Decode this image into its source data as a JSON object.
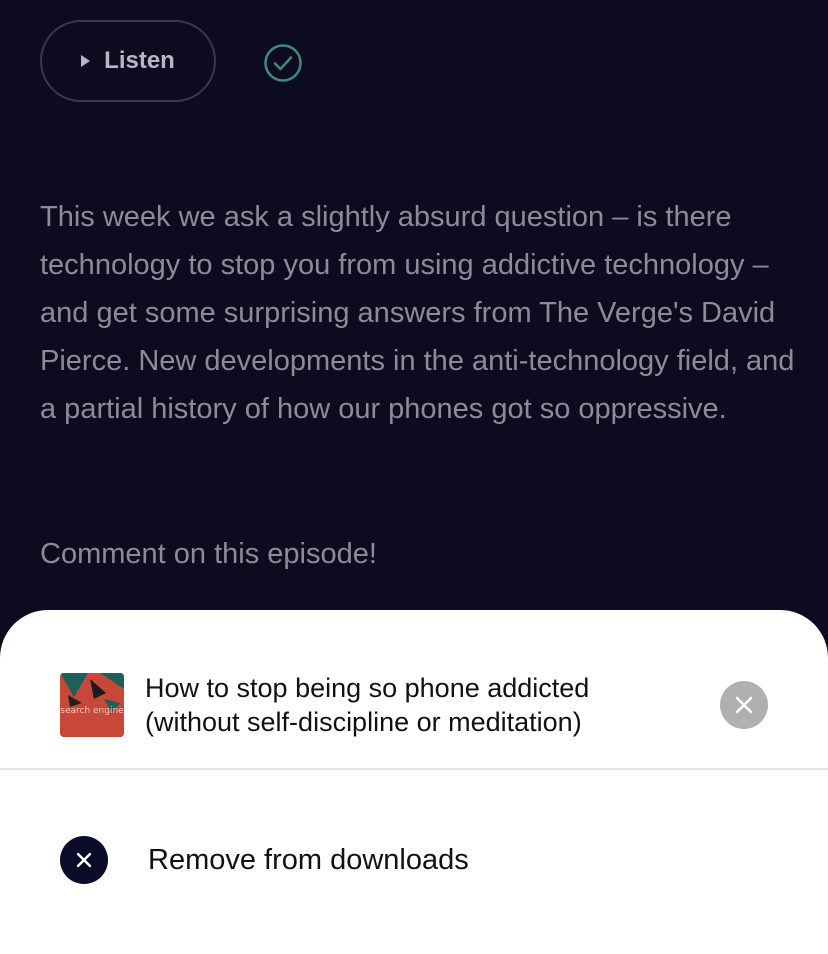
{
  "top": {
    "listen_label": "Listen",
    "play_icon": "play-icon",
    "check_icon": "checkmark-circle-icon"
  },
  "episode": {
    "description": "This week we ask a slightly absurd question – is there technology to stop you from using addictive technology – and get some surprising answers from The Verge's David Pierce. New developments in the anti-technology field, and a partial history of how our phones got so oppressive.",
    "comment_link": "Comment on this episode!"
  },
  "sheet": {
    "artwork_text": "search engine",
    "title_line1": "How to stop being so phone addicted",
    "title_line2": "(without self-discipline or meditation)",
    "close_icon": "close-icon",
    "remove_label": "Remove from downloads",
    "remove_icon": "remove-icon"
  },
  "colors": {
    "background": "#0d0b1f",
    "accent_check": "#3f8a7d",
    "sheet": "#ffffff",
    "remove_icon_bg": "#0d0b2a",
    "close_bg": "#b0b0b3"
  }
}
